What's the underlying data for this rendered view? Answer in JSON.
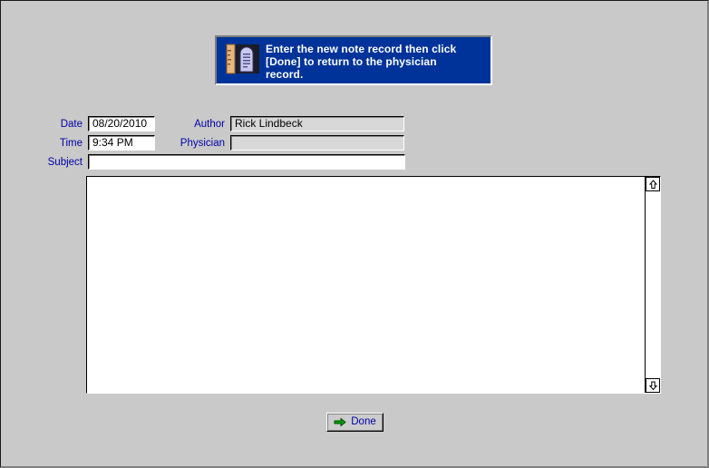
{
  "banner": {
    "icon": "note-document-ruler-icon",
    "lines": [
      "Enter the new note record then click",
      "[Done] to return to the physician",
      "record."
    ],
    "background_color": "#003399",
    "text_color": "#ffffff"
  },
  "form": {
    "fields": [
      {
        "name": "date",
        "label": "Date",
        "value": "08/20/2010",
        "placeholder": "",
        "readonly": false
      },
      {
        "name": "time",
        "label": "Time",
        "value": "9:34 PM",
        "placeholder": "",
        "readonly": false
      },
      {
        "name": "author",
        "label": "Author",
        "value": "Rick Lindbeck",
        "placeholder": "",
        "readonly": true
      },
      {
        "name": "physician",
        "label": "Physician",
        "value": "",
        "placeholder": "",
        "readonly": true
      },
      {
        "name": "subject",
        "label": "Subject",
        "value": "",
        "placeholder": "",
        "readonly": false
      }
    ]
  },
  "note_body": {
    "value": "",
    "placeholder": ""
  },
  "scrollbar": {
    "up_arrow": "arrow-up-icon",
    "down_arrow": "arrow-down-icon"
  },
  "actions": {
    "done_label": "Done",
    "done_icon": "green-right-arrow-icon"
  },
  "colors": {
    "window_background": "#c9c9c9",
    "label_text": "#0000a8",
    "banner_background": "#003399",
    "button_arrow": "#008000",
    "readonly_field": "#d8d8d8"
  }
}
